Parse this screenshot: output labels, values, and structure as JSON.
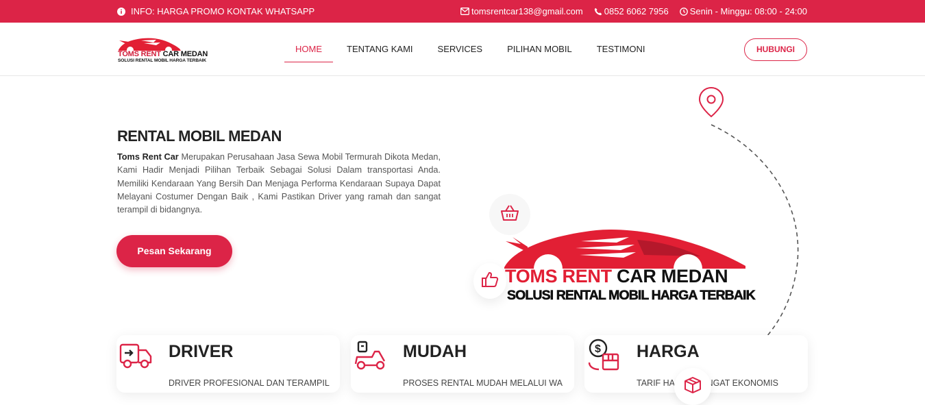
{
  "topbar": {
    "info": "INFO: HARGA PROMO KONTAK WHATSAPP",
    "email": "tomsrentcar138@gmail.com",
    "phone": "0852 6062 7956",
    "hours": "Senin - Minggu: 08:00 - 24:00"
  },
  "header": {
    "logo_line1_red": "TOMS RENT ",
    "logo_line1_black": "CAR MEDAN",
    "logo_line2": "SOLUSI RENTAL MOBIL HARGA TERBAIK",
    "nav": [
      "HOME",
      "TENTANG KAMI",
      "SERVICES",
      "PILIHAN MOBIL",
      "TESTIMONI"
    ],
    "active_nav": "HOME",
    "cta": "HUBUNGI"
  },
  "hero": {
    "title": "RENTAL MOBIL MEDAN",
    "text_bold": "Toms Rent Car",
    "text": " Merupakan Perusahaan Jasa Sewa Mobil Termurah Dikota Medan, Kami Hadir Menjadi Pilihan Terbaik Sebagai Solusi Dalam transportasi Anda. Memiliki Kendaraan Yang Bersih Dan Menjaga Performa Kendaraan Supaya Dapat Melayani Costumer Dengan Baik , Kami Pastikan Driver yang ramah dan sangat terampil di bidangnya.",
    "button": "Pesan Sekarang"
  },
  "brand": {
    "name_red": "TOMS RENT ",
    "name_black": "CAR MEDAN",
    "tagline": "SOLUSI RENTAL MOBIL HARGA TERBAIK"
  },
  "features": [
    {
      "title": "DRIVER",
      "desc": "DRIVER PROFESIONAL DAN TERAMPIL",
      "icon": "delivery-truck-icon"
    },
    {
      "title": "MUDAH",
      "desc": "PROSES RENTAL MUDAH MELALUI WA",
      "icon": "scooter-delivery-icon"
    },
    {
      "title": "HARGA",
      "desc": "TARIF HARGA SANGAT EKONOMIS",
      "icon": "price-box-icon"
    }
  ],
  "colors": {
    "accent": "#dc2447",
    "text": "#222222"
  }
}
